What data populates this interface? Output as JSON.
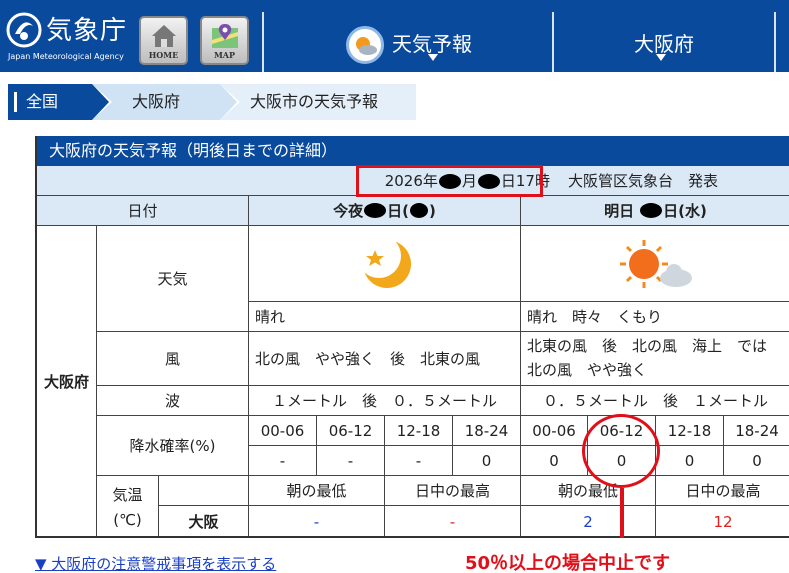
{
  "header": {
    "logo_jp": "気象庁",
    "logo_en": "Japan Meteorological Agency",
    "home_label": "HOME",
    "map_label": "MAP",
    "menu_forecast": "天気予報",
    "menu_pref": "大阪府"
  },
  "breadcrumb": [
    "全国",
    "大阪府",
    "大阪市の天気予報"
  ],
  "panel": {
    "title": "大阪府の天気予報（明後日までの詳細）",
    "issue_year": "2026年",
    "issue_mid": "月",
    "issue_end": "日17時",
    "issuer": "大阪管区気象台　発表",
    "date_label": "日付",
    "day1_a": "今夜",
    "day1_b": "日(",
    "day1_c": ")",
    "day2_a": "明日",
    "day2_b": "日(水)",
    "region": "大阪府",
    "row_weather": "天気",
    "row_wind": "風",
    "row_wave": "波",
    "row_pop": "降水確率(%)",
    "row_temp": "気温",
    "row_temp_unit": "(℃)",
    "temp_city": "大阪",
    "weather_day1": "晴れ",
    "weather_day2": "晴れ　時々　くもり",
    "wind_day1": "北の風　やや強く　後　北東の風",
    "wind_day2": "北東の風　後　北の風　海上　では　北の風　やや強く",
    "wave_day1": "１メートル　後　０．５メートル",
    "wave_day2": "０．５メートル　後　１メートル",
    "pop_times": [
      "00-06",
      "06-12",
      "12-18",
      "18-24",
      "00-06",
      "06-12",
      "12-18",
      "18-24"
    ],
    "pop_values": [
      "-",
      "-",
      "-",
      "0",
      "0",
      "0",
      "0",
      "0"
    ],
    "temp_min_label": "朝の最低",
    "temp_max_label": "日中の最高",
    "temp_day1_min": "-",
    "temp_day1_max": "-",
    "temp_day2_min": "2",
    "temp_day2_max": "12"
  },
  "icons": {
    "day1_weather": "moon-star-icon",
    "day2_weather": "sun-cloud-icon"
  },
  "colors": {
    "brand_blue": "#0a4a9c",
    "header_cell": "#dbe9f7",
    "min_temp": "#1a3fc4",
    "max_temp": "#e02020",
    "annotation": "#e0101a"
  },
  "annotation_note": "50％以上の場合中止です",
  "warning_link": "▼ 大阪府の注意警戒事項を表示する"
}
